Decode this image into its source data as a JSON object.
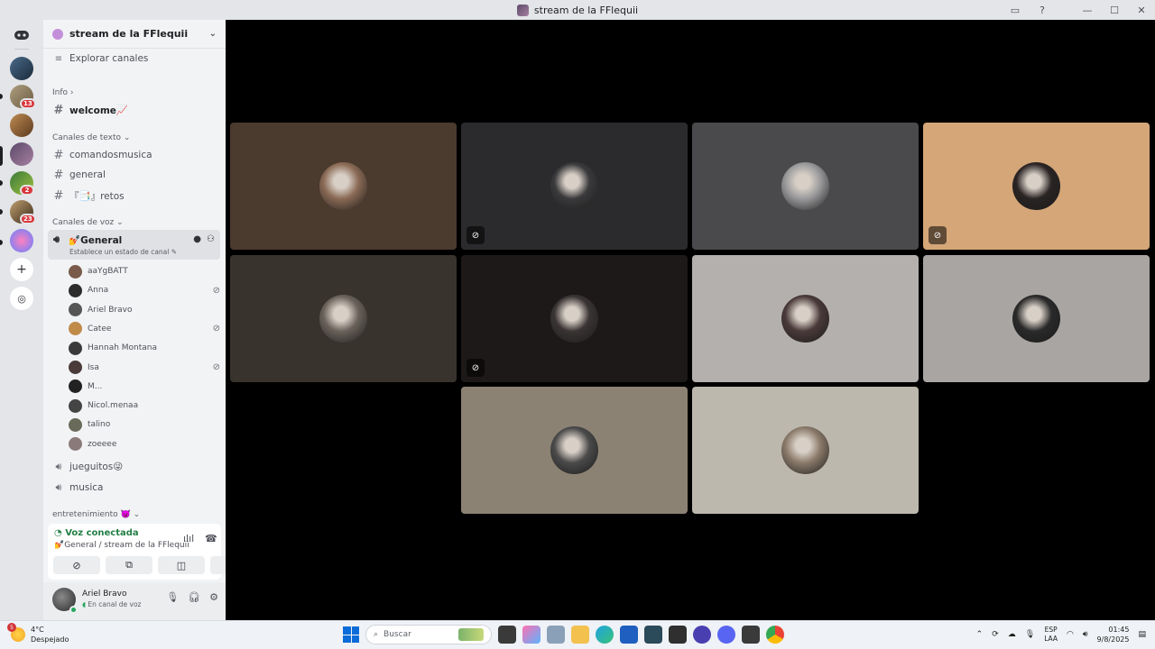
{
  "window": {
    "title": "stream de la FFlequii"
  },
  "rail": {
    "badges": [
      "13",
      "2",
      "23"
    ]
  },
  "sidebar": {
    "server_name": "stream de la FFlequii",
    "browse_channels": "Explorar canales",
    "info_label": "Info",
    "info_channels": [
      {
        "name": "welcome📈"
      }
    ],
    "text_category": "Canales de texto",
    "text_channels": [
      {
        "name": "comandosmusica"
      },
      {
        "name": "general"
      },
      {
        "name": "『📑』retos"
      }
    ],
    "voice_category": "Canales de voz",
    "active_voice": {
      "name": "💅General",
      "status_hint": "Establece un estado de canal ✎"
    },
    "voice_members": [
      {
        "name": "aaYgBATT",
        "muted": false,
        "color": "#7a5a4a"
      },
      {
        "name": "Anna",
        "muted": true,
        "color": "#2b2b2b"
      },
      {
        "name": "Ariel Bravo",
        "muted": false,
        "color": "#555"
      },
      {
        "name": "Catee",
        "muted": true,
        "color": "#c08a48"
      },
      {
        "name": "Hannah Montana",
        "muted": false,
        "color": "#3a3a3a"
      },
      {
        "name": "Isa",
        "muted": true,
        "color": "#4a3a3a"
      },
      {
        "name": "M...",
        "muted": false,
        "color": "#222"
      },
      {
        "name": "Nicol.menaa",
        "muted": false,
        "color": "#444"
      },
      {
        "name": "talino",
        "muted": false,
        "color": "#6a6a5a"
      },
      {
        "name": "zoeeee",
        "muted": false,
        "color": "#8a7a7a"
      }
    ],
    "other_voice_channels": [
      {
        "name": "jueguitos😜"
      },
      {
        "name": "musica"
      }
    ],
    "entertainment_category": "entretenimiento 👿"
  },
  "voice_panel": {
    "status": "Voz conectada",
    "location": "💅General / stream de la FFlequii"
  },
  "user_panel": {
    "name": "Ariel Bravo",
    "status": "En canal de voz"
  },
  "stage": {
    "tiles": [
      {
        "bg": "#4b3a2e",
        "pfp": "#8a6a55",
        "muted": false
      },
      {
        "bg": "#2b2b2d",
        "pfp": "#3a3a3c",
        "muted": true
      },
      {
        "bg": "#4a4a4c",
        "pfp": "#9a9a9c",
        "muted": false
      },
      {
        "bg": "#d4a678",
        "pfp": "#2a2424",
        "muted": true
      },
      {
        "bg": "#38332d",
        "pfp": "#6a625a",
        "muted": false
      },
      {
        "bg": "#1c1918",
        "pfp": "#3a3434",
        "muted": true
      },
      {
        "bg": "#b4b0ae",
        "pfp": "#4a3a3a",
        "muted": false
      },
      {
        "bg": "#a8a5a2",
        "pfp": "#2a2a2a",
        "muted": false
      },
      {
        "bg": "#8c8273",
        "pfp": "#4a4a4a",
        "muted": false
      },
      {
        "bg": "#bcb8ad",
        "pfp": "#8a7a6a",
        "muted": false
      }
    ]
  },
  "taskbar": {
    "weather_temp": "4°C",
    "weather_desc": "Despejado",
    "weather_badge": "5",
    "search_placeholder": "Buscar",
    "lang_top": "ESP",
    "lang_bottom": "LAA",
    "time": "01:45",
    "date": "9/8/2025"
  }
}
